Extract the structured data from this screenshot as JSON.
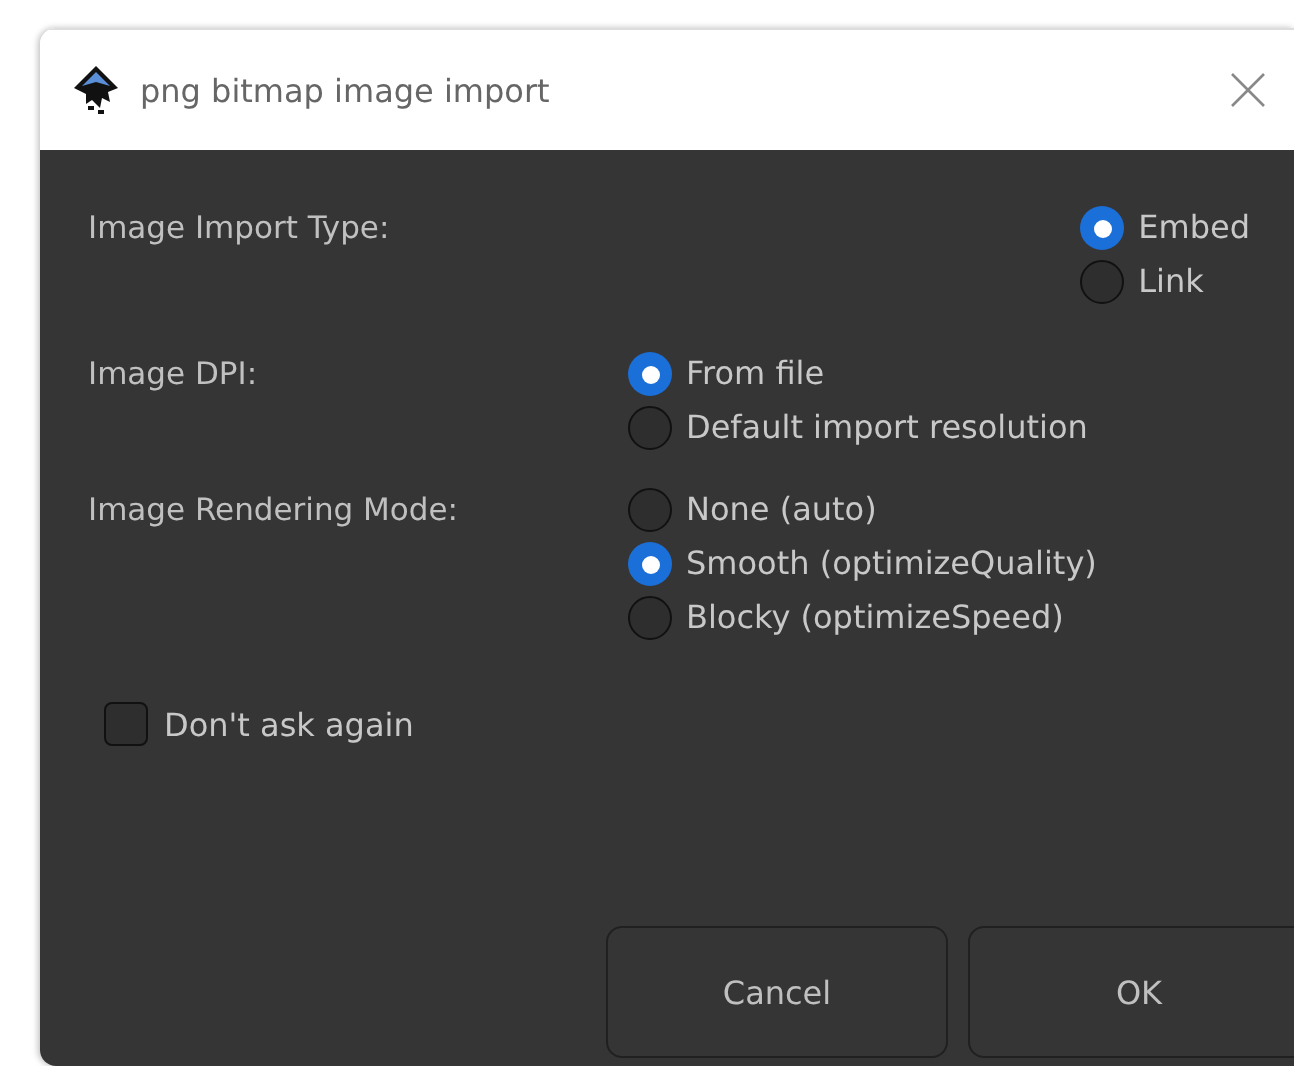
{
  "window": {
    "title": "png bitmap image import"
  },
  "sections": [
    {
      "label": "Image Import Type:",
      "options": [
        {
          "label": "Embed",
          "selected": true
        },
        {
          "label": "Link",
          "selected": false
        }
      ]
    },
    {
      "label": "Image DPI:",
      "options": [
        {
          "label": "From file",
          "selected": true
        },
        {
          "label": "Default import resolution",
          "selected": false
        }
      ]
    },
    {
      "label": "Image Rendering Mode:",
      "options": [
        {
          "label": "None (auto)",
          "selected": false
        },
        {
          "label": "Smooth (optimizeQuality)",
          "selected": true
        },
        {
          "label": "Blocky (optimizeSpeed)",
          "selected": false
        }
      ]
    }
  ],
  "dont_ask": {
    "label": "Don't ask again",
    "checked": false
  },
  "buttons": [
    "Cancel",
    "OK"
  ]
}
